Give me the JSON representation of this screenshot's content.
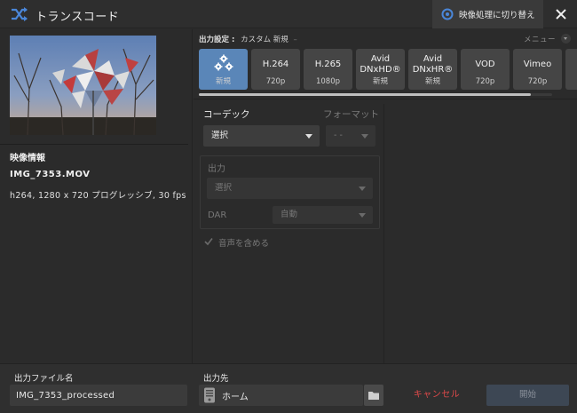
{
  "window": {
    "title": "トランスコード",
    "switch_label": "映像処理に切り替え"
  },
  "preview": {
    "heading": "映像情報",
    "file_name": "IMG_7353.MOV",
    "details": "h264, 1280 x 720 プログレッシブ, 30 fps"
  },
  "presets": {
    "header_label": "出力設定 :",
    "current": "カスタム 新規",
    "dash": "–",
    "menu_label": "メニュー",
    "items": [
      {
        "name": "",
        "sub": "新規",
        "icon": "gears-icon"
      },
      {
        "name": "H.264",
        "sub": "720p"
      },
      {
        "name": "H.265",
        "sub": "1080p"
      },
      {
        "name": "Avid\nDNxHD®",
        "sub": "新規"
      },
      {
        "name": "Avid\nDNxHR®",
        "sub": "新規"
      },
      {
        "name": "VOD",
        "sub": "720p"
      },
      {
        "name": "Vimeo",
        "sub": "720p"
      },
      {
        "name": "",
        "sub": ""
      }
    ],
    "scroll_fraction": 0.94
  },
  "settings": {
    "codec_label": "コーデック",
    "format_label": "フォーマット",
    "codec_value": "選択",
    "format_value": "- -",
    "output_label": "出力",
    "output_value": "選択",
    "dar_label": "DAR",
    "dar_value": "自動",
    "audio_label": "音声を含める",
    "audio_checked": true
  },
  "footer": {
    "output_file_label": "出力ファイル名",
    "output_file_value": "IMG_7353_processed",
    "destination_label": "出力先",
    "destination_value": "ホーム",
    "cancel_label": "キャンセル",
    "start_label": "開始"
  },
  "colors": {
    "accent": "#5a86b8",
    "cancel": "#e04a4a",
    "background": "#2b2b2b"
  }
}
